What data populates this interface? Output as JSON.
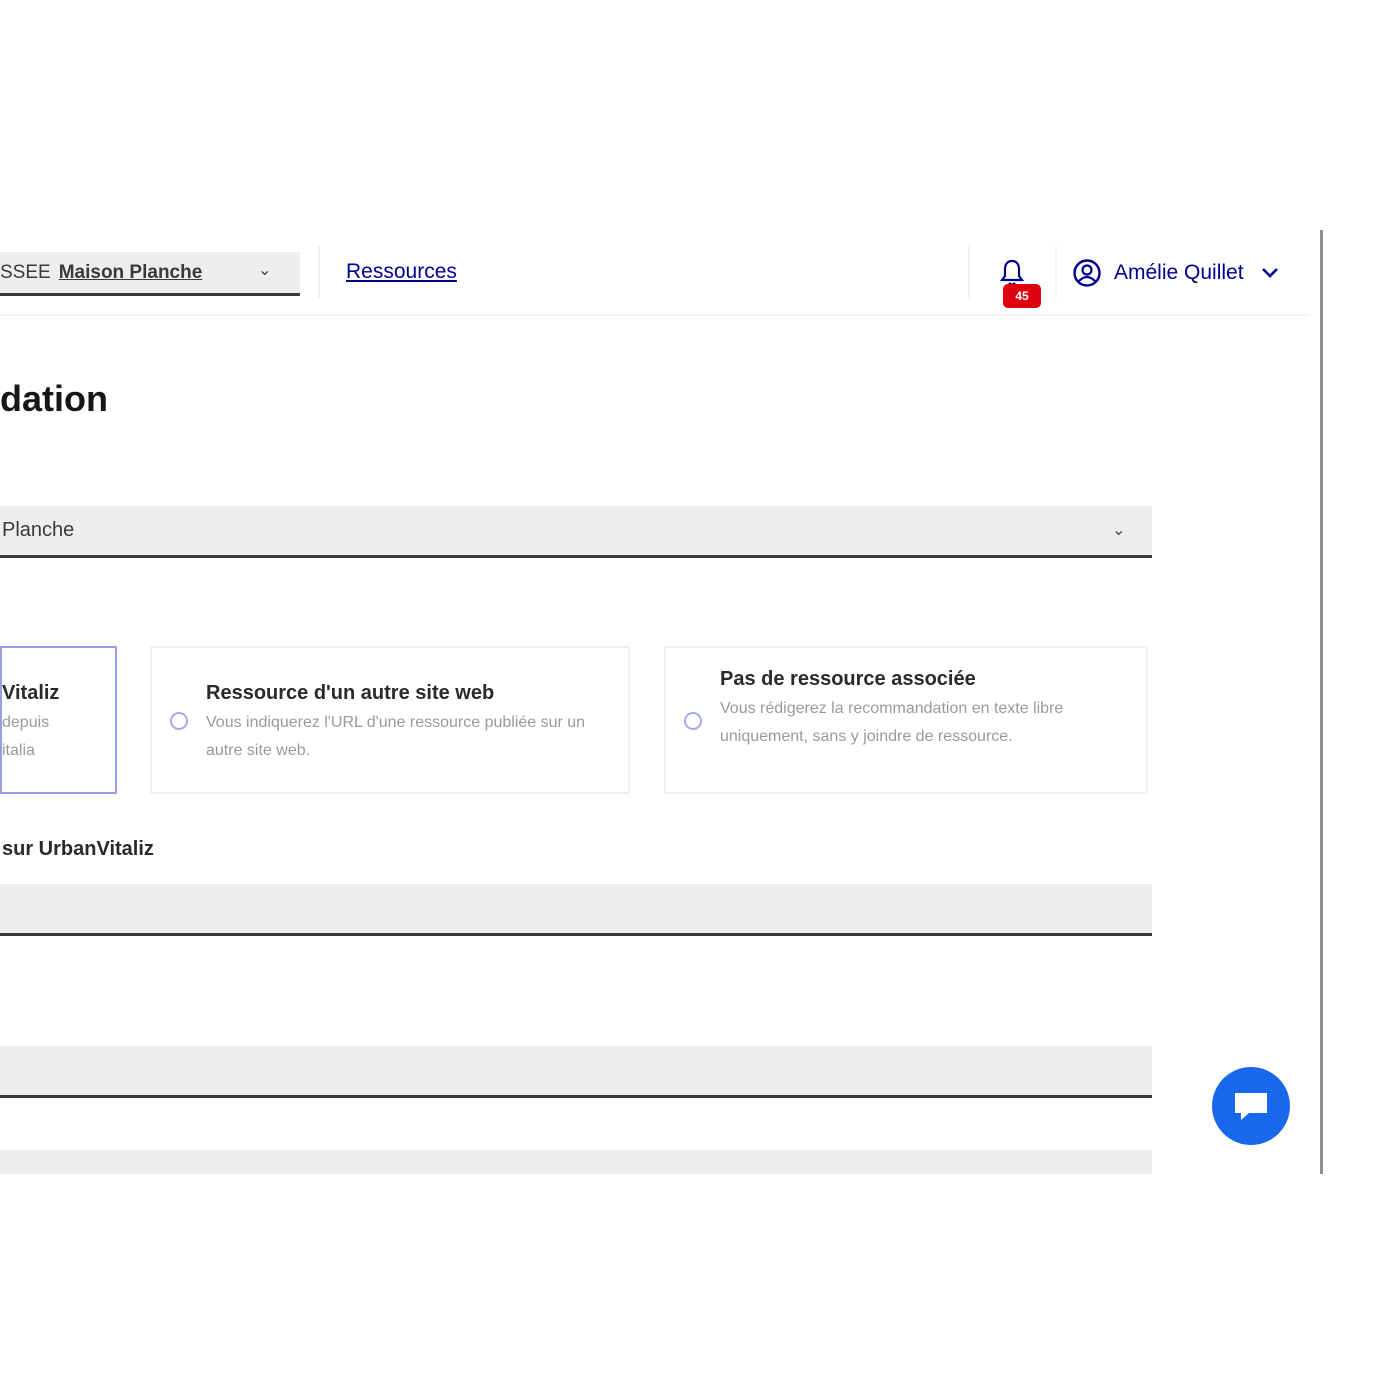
{
  "header": {
    "project_select_prefix": "SSEE",
    "project_select_name": "Maison Planche",
    "nav_link": "Ressources",
    "notification_count": "45",
    "user_name": "Amélie Quillet"
  },
  "main": {
    "title": "dation",
    "project_select_value": "Planche",
    "resource_options": [
      {
        "title": "Vitaliz",
        "description": "depuis\nitalia"
      },
      {
        "title": "Ressource d'un autre site web",
        "description": "Vous indiquerez l'URL d'une ressource publiée sur un autre site web."
      },
      {
        "title": "Pas de ressource associée",
        "description": "Vous rédigerez la recommandation en texte libre uniquement, sans y joindre de ressource."
      }
    ],
    "resource_field_label": "sur UrbanVitaliz"
  },
  "colors": {
    "accent": "#000091",
    "badge": "#e1000f",
    "chat_button": "#1868ec",
    "field_bg": "#eeeeee"
  },
  "icons": {
    "notification": "bell-icon",
    "user": "user-circle-icon",
    "chat": "chat-bubble-icon"
  }
}
